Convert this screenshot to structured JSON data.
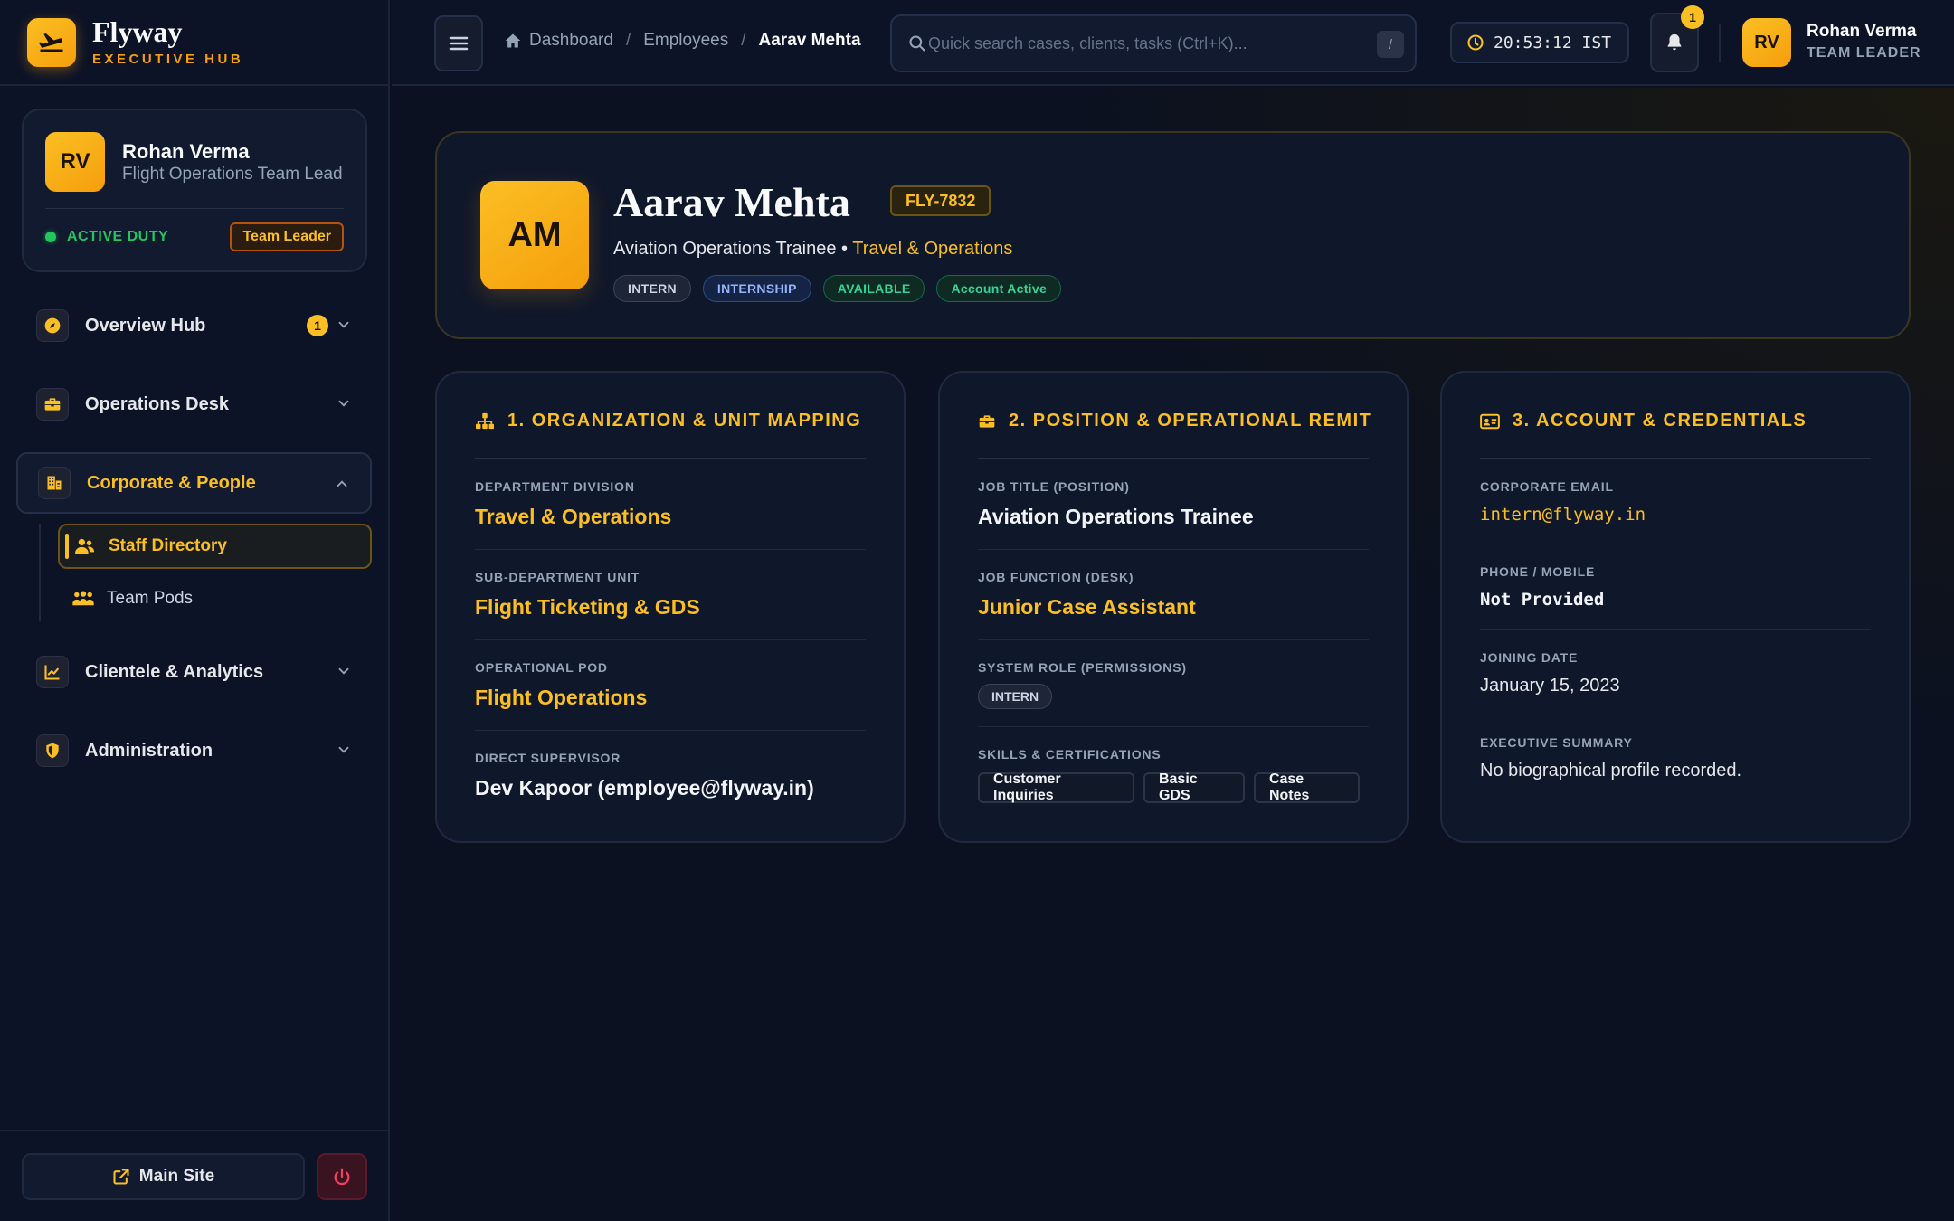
{
  "brand": {
    "name": "Flyway",
    "sub": "EXECUTIVE HUB"
  },
  "user_card": {
    "initials": "RV",
    "name": "Rohan Verma",
    "role": "Flight Operations Team Lead",
    "status": "ACTIVE DUTY",
    "badge": "Team Leader"
  },
  "nav": {
    "items": [
      {
        "label": "Overview Hub",
        "icon": "compass-icon",
        "count": "1"
      },
      {
        "label": "Operations Desk",
        "icon": "briefcase-icon"
      },
      {
        "label": "Corporate & People",
        "icon": "building-icon",
        "expanded": true,
        "children": [
          {
            "label": "Staff Directory",
            "icon": "users-icon",
            "active": true
          },
          {
            "label": "Team Pods",
            "icon": "group-icon"
          }
        ]
      },
      {
        "label": "Clientele & Analytics",
        "icon": "chart-line-icon"
      },
      {
        "label": "Administration",
        "icon": "shield-icon"
      }
    ]
  },
  "footer": {
    "main_site": "Main Site"
  },
  "topbar": {
    "breadcrumb": [
      "Dashboard",
      "Employees",
      "Aarav Mehta"
    ],
    "search_placeholder": "Quick search cases, clients, tasks (Ctrl+K)...",
    "search_kbd": "/",
    "clock": "20:53:12 IST",
    "notifications": "1",
    "user_initials": "RV",
    "user_name": "Rohan Verma",
    "user_role": "TEAM LEADER"
  },
  "profile": {
    "initials": "AM",
    "name": "Aarav Mehta",
    "code": "FLY-7832",
    "position": "Aviation Operations Trainee",
    "department": "Travel & Operations",
    "tags": [
      "INTERN",
      "INTERNSHIP",
      "AVAILABLE",
      "Account Active"
    ]
  },
  "cards": {
    "org": {
      "title": "1. ORGANIZATION & UNIT MAPPING",
      "fields": [
        {
          "label": "DEPARTMENT DIVISION",
          "value": "Travel & Operations"
        },
        {
          "label": "SUB-DEPARTMENT UNIT",
          "value": "Flight Ticketing & GDS"
        },
        {
          "label": "OPERATIONAL POD",
          "value": "Flight Operations"
        },
        {
          "label": "DIRECT SUPERVISOR",
          "value": "Dev Kapoor (employee@flyway.in)"
        }
      ]
    },
    "position": {
      "title": "2. POSITION & OPERATIONAL REMIT",
      "fields": [
        {
          "label": "JOB TITLE (POSITION)",
          "value": "Aviation Operations Trainee"
        },
        {
          "label": "JOB FUNCTION (DESK)",
          "value": "Junior Case Assistant"
        },
        {
          "label": "SYSTEM ROLE (PERMISSIONS)",
          "value": "INTERN"
        },
        {
          "label": "SKILLS & CERTIFICATIONS",
          "skills": [
            "Customer Inquiries",
            "Basic GDS",
            "Case Notes"
          ]
        }
      ]
    },
    "account": {
      "title": "3. ACCOUNT & CREDENTIALS",
      "fields": [
        {
          "label": "CORPORATE EMAIL",
          "value": "intern@flyway.in"
        },
        {
          "label": "PHONE / MOBILE",
          "value": "Not Provided"
        },
        {
          "label": "JOINING DATE",
          "value": "January 15, 2023"
        },
        {
          "label": "EXECUTIVE SUMMARY",
          "value": "No biographical profile recorded."
        }
      ]
    }
  },
  "colors": {
    "accent": "#fbbf24",
    "background": "#0b1120",
    "success": "#22c55e",
    "info": "#93b4fb"
  }
}
